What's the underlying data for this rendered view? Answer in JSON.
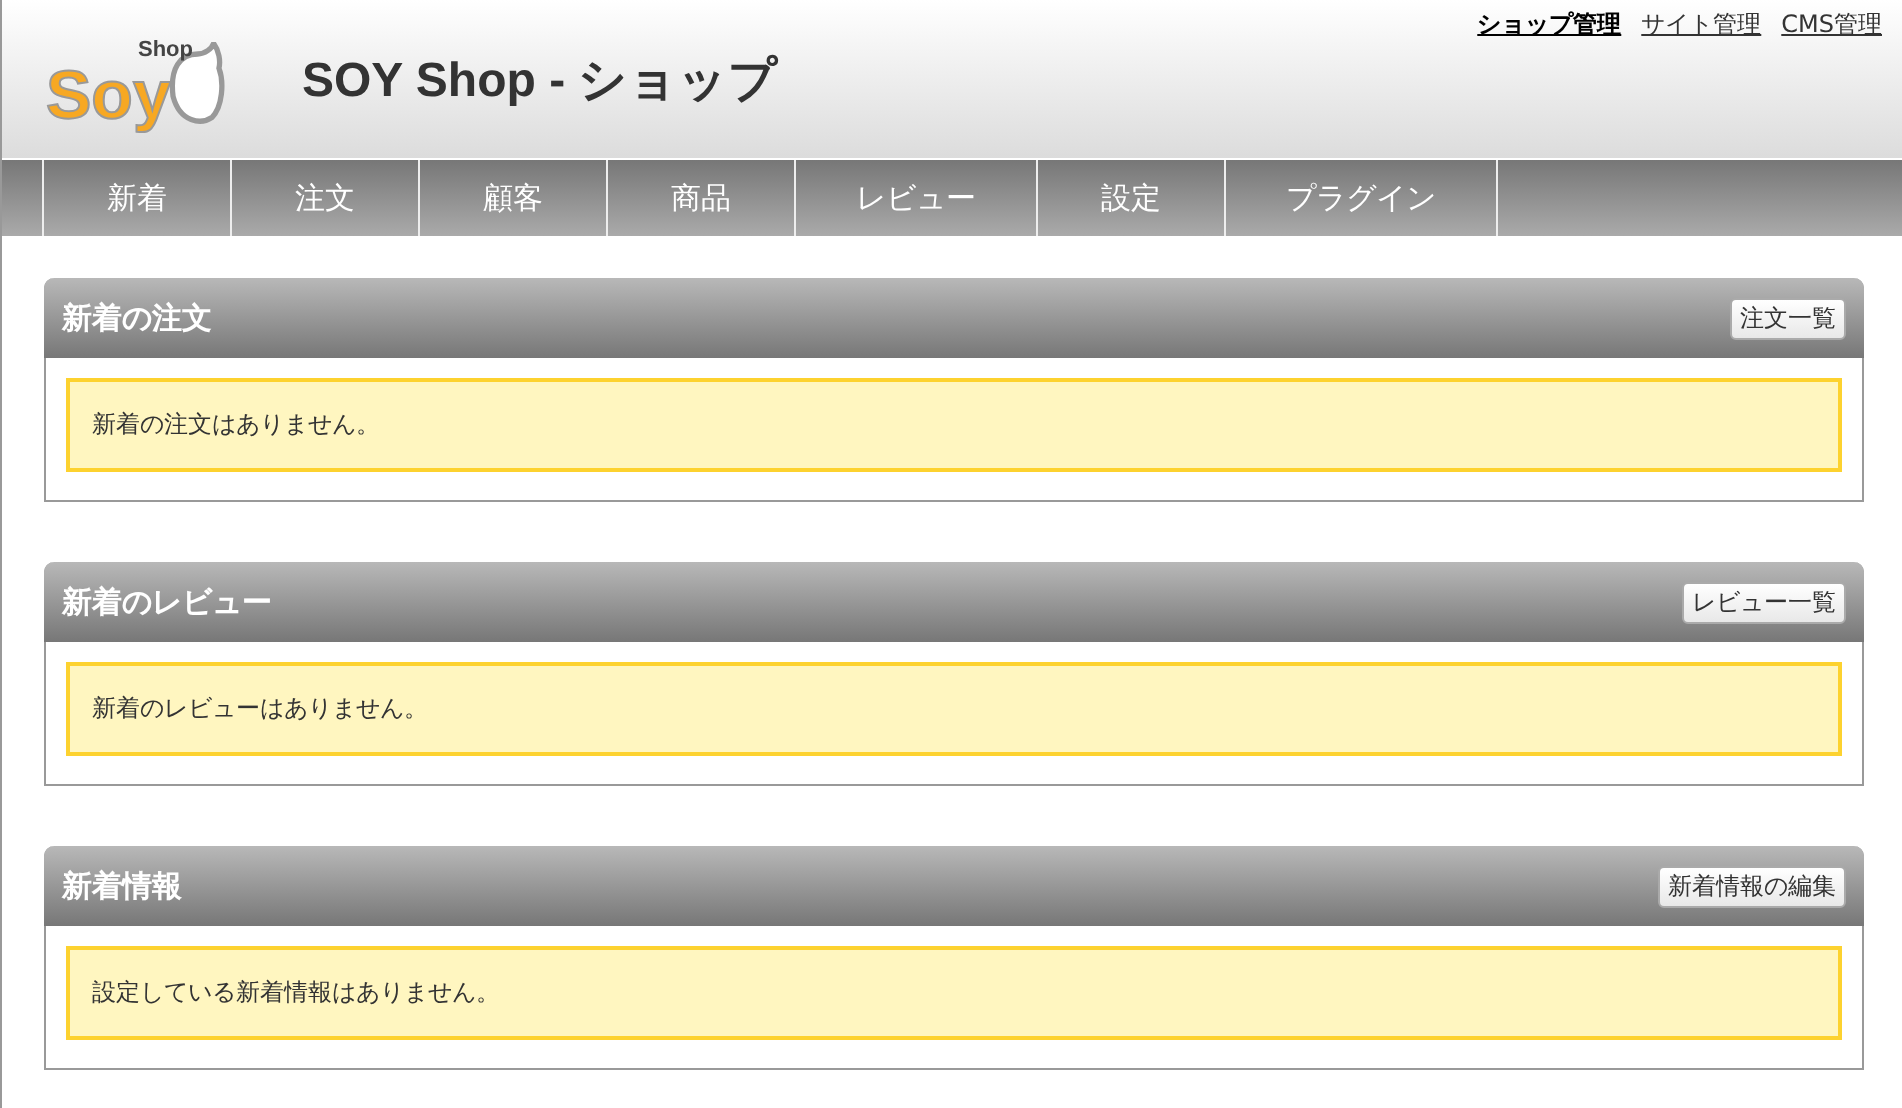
{
  "logo": {
    "small": "Shop",
    "word": "Soy"
  },
  "title": "SOY Shop - ショップ",
  "header_links": [
    {
      "label": "ショップ管理",
      "selected": true
    },
    {
      "label": "サイト管理",
      "selected": false
    },
    {
      "label": "CMS管理",
      "selected": false
    }
  ],
  "nav": [
    "新着",
    "注文",
    "顧客",
    "商品",
    "レビュー",
    "設定",
    "プラグイン"
  ],
  "panels": [
    {
      "title": "新着の注文",
      "button": "注文一覧",
      "message": "新着の注文はありません。"
    },
    {
      "title": "新着のレビュー",
      "button": "レビュー一覧",
      "message": "新着のレビューはありません。"
    },
    {
      "title": "新着情報",
      "button": "新着情報の編集",
      "message": "設定している新着情報はありません。"
    }
  ]
}
